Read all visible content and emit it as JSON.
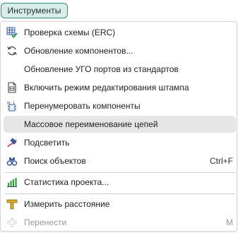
{
  "menubar": {
    "tools_label": "Инструменты"
  },
  "menu": {
    "items": [
      {
        "label": "Проверка схемы (ERC)",
        "icon": "grid-check-icon"
      },
      {
        "label": "Обновление компонентов...",
        "icon": "refresh-icon"
      },
      {
        "label": "Обновление УГО портов из стандартов",
        "icon": ""
      },
      {
        "label": "Включить режим редактирования штампа",
        "icon": "document-edit-icon"
      },
      {
        "label": "Перенумеровать компоненты",
        "icon": "renumber-icon"
      },
      {
        "label": "Массовое переименование цепей",
        "icon": ""
      },
      {
        "label": "Подсветить",
        "icon": "highlighter-icon"
      },
      {
        "label": "Поиск объектов",
        "shortcut": "Ctrl+F",
        "icon": "binoculars-icon"
      },
      {
        "label": "Статистика проекта...",
        "icon": "bar-chart-icon"
      },
      {
        "label": "Измерить расстояние",
        "icon": "ruler-icon"
      },
      {
        "label": "Перенести",
        "shortcut": "M",
        "icon": "move-icon"
      }
    ]
  },
  "colors": {
    "accent": "#2e8c7f",
    "accent_bg": "#d8ece8",
    "highlight_bg": "#e6e6e6",
    "disabled_text": "#9a9a9a"
  }
}
